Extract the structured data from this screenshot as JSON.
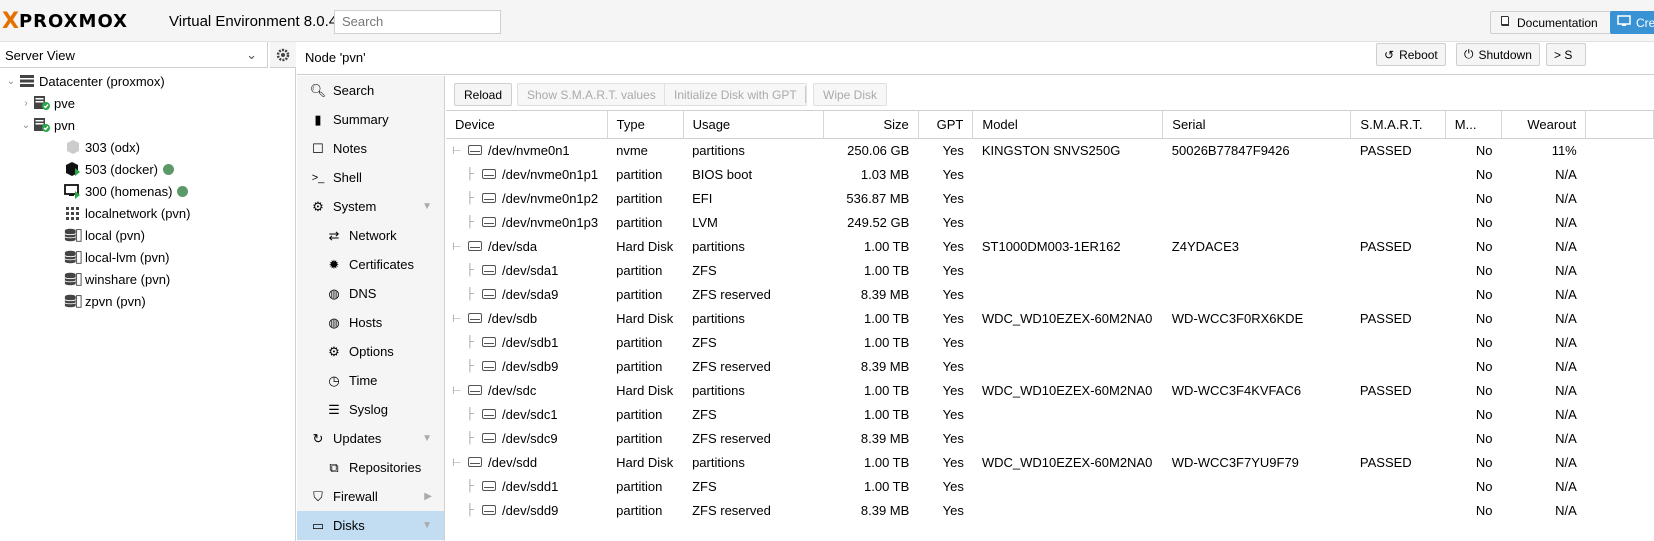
{
  "app": {
    "logo_x": "X",
    "logo_word": "PROXMOX",
    "version": "Virtual Environment 8.0.4",
    "search_placeholder": "Search",
    "documentation_label": "Documentation",
    "create_label": "Cre"
  },
  "sidebar": {
    "view_label": "Server View",
    "tree": [
      {
        "label": "Datacenter (proxmox)",
        "icon": "datacenter-icon",
        "level": 0,
        "toggle": "expanded"
      },
      {
        "label": "pve",
        "icon": "node-online-icon",
        "level": 1,
        "toggle": "collapsed"
      },
      {
        "label": "pvn",
        "icon": "node-online-icon",
        "level": 1,
        "toggle": "expanded"
      },
      {
        "label": "303 (odx)",
        "icon": "container-stopped-icon",
        "level": 2,
        "status": ""
      },
      {
        "label": "503 (docker)",
        "icon": "container-running-icon",
        "level": 2,
        "status": "tag"
      },
      {
        "label": "300 (homenas)",
        "icon": "vm-running-icon",
        "level": 2,
        "status": "tag"
      },
      {
        "label": "localnetwork (pvn)",
        "icon": "network-icon",
        "level": 2,
        "status": ""
      },
      {
        "label": "local (pvn)",
        "icon": "storage-icon",
        "level": 2,
        "status": ""
      },
      {
        "label": "local-lvm (pvn)",
        "icon": "storage-icon",
        "level": 2,
        "status": ""
      },
      {
        "label": "winshare (pvn)",
        "icon": "storage-icon",
        "level": 2,
        "status": ""
      },
      {
        "label": "zpvn (pvn)",
        "icon": "storage-icon",
        "level": 2,
        "status": ""
      }
    ]
  },
  "header": {
    "node_title": "Node 'pvn'",
    "reboot_label": "Reboot",
    "shutdown_label": "Shutdown",
    "shell_label": "> S"
  },
  "nav": [
    {
      "label": "Search",
      "icon": "search-icon",
      "sub": false
    },
    {
      "label": "Summary",
      "icon": "book-icon",
      "sub": false
    },
    {
      "label": "Notes",
      "icon": "notes-icon",
      "sub": false
    },
    {
      "label": "Shell",
      "icon": "terminal-icon",
      "sub": false
    },
    {
      "label": "System",
      "icon": "cogs-icon",
      "sub": false,
      "caret": "down"
    },
    {
      "label": "Network",
      "icon": "exchange-icon",
      "sub": true
    },
    {
      "label": "Certificates",
      "icon": "certificate-icon",
      "sub": true
    },
    {
      "label": "DNS",
      "icon": "globe-icon",
      "sub": true
    },
    {
      "label": "Hosts",
      "icon": "globe-icon",
      "sub": true
    },
    {
      "label": "Options",
      "icon": "gear-icon",
      "sub": true
    },
    {
      "label": "Time",
      "icon": "clock-icon",
      "sub": true
    },
    {
      "label": "Syslog",
      "icon": "list-icon",
      "sub": true
    },
    {
      "label": "Updates",
      "icon": "refresh-icon",
      "sub": false,
      "caret": "down"
    },
    {
      "label": "Repositories",
      "icon": "files-icon",
      "sub": true
    },
    {
      "label": "Firewall",
      "icon": "shield-icon",
      "sub": false,
      "caret": "right"
    },
    {
      "label": "Disks",
      "icon": "hdd-icon",
      "sub": false,
      "caret": "down",
      "active": true
    }
  ],
  "toolbar": {
    "reload": "Reload",
    "smart": "Show S.M.A.R.T. values",
    "init_gpt": "Initialize Disk with GPT",
    "wipe": "Wipe Disk"
  },
  "table": {
    "columns": [
      "Device",
      "Type",
      "Usage",
      "Size",
      "GPT",
      "Model",
      "Serial",
      "S.M.A.R.T.",
      "M...",
      "Wearout"
    ],
    "rows": [
      {
        "device": "/dev/nvme0n1",
        "type": "nvme",
        "usage": "partitions",
        "size": "250.06 GB",
        "gpt": "Yes",
        "model": "KINGSTON SNVS250G",
        "serial": "50026B77847F9426",
        "smart": "PASSED",
        "mounted": "No",
        "wearout": "11%",
        "child": false
      },
      {
        "device": "/dev/nvme0n1p1",
        "type": "partition",
        "usage": "BIOS boot",
        "size": "1.03 MB",
        "gpt": "Yes",
        "model": "",
        "serial": "",
        "smart": "",
        "mounted": "No",
        "wearout": "N/A",
        "child": true
      },
      {
        "device": "/dev/nvme0n1p2",
        "type": "partition",
        "usage": "EFI",
        "size": "536.87 MB",
        "gpt": "Yes",
        "model": "",
        "serial": "",
        "smart": "",
        "mounted": "No",
        "wearout": "N/A",
        "child": true
      },
      {
        "device": "/dev/nvme0n1p3",
        "type": "partition",
        "usage": "LVM",
        "size": "249.52 GB",
        "gpt": "Yes",
        "model": "",
        "serial": "",
        "smart": "",
        "mounted": "No",
        "wearout": "N/A",
        "child": true
      },
      {
        "device": "/dev/sda",
        "type": "Hard Disk",
        "usage": "partitions",
        "size": "1.00 TB",
        "gpt": "Yes",
        "model": "ST1000DM003-1ER162",
        "serial": "Z4YDACE3",
        "smart": "PASSED",
        "mounted": "No",
        "wearout": "N/A",
        "child": false
      },
      {
        "device": "/dev/sda1",
        "type": "partition",
        "usage": "ZFS",
        "size": "1.00 TB",
        "gpt": "Yes",
        "model": "",
        "serial": "",
        "smart": "",
        "mounted": "No",
        "wearout": "N/A",
        "child": true
      },
      {
        "device": "/dev/sda9",
        "type": "partition",
        "usage": "ZFS reserved",
        "size": "8.39 MB",
        "gpt": "Yes",
        "model": "",
        "serial": "",
        "smart": "",
        "mounted": "No",
        "wearout": "N/A",
        "child": true
      },
      {
        "device": "/dev/sdb",
        "type": "Hard Disk",
        "usage": "partitions",
        "size": "1.00 TB",
        "gpt": "Yes",
        "model": "WDC_WD10EZEX-60M2NA0",
        "serial": "WD-WCC3F0RX6KDE",
        "smart": "PASSED",
        "mounted": "No",
        "wearout": "N/A",
        "child": false
      },
      {
        "device": "/dev/sdb1",
        "type": "partition",
        "usage": "ZFS",
        "size": "1.00 TB",
        "gpt": "Yes",
        "model": "",
        "serial": "",
        "smart": "",
        "mounted": "No",
        "wearout": "N/A",
        "child": true
      },
      {
        "device": "/dev/sdb9",
        "type": "partition",
        "usage": "ZFS reserved",
        "size": "8.39 MB",
        "gpt": "Yes",
        "model": "",
        "serial": "",
        "smart": "",
        "mounted": "No",
        "wearout": "N/A",
        "child": true
      },
      {
        "device": "/dev/sdc",
        "type": "Hard Disk",
        "usage": "partitions",
        "size": "1.00 TB",
        "gpt": "Yes",
        "model": "WDC_WD10EZEX-60M2NA0",
        "serial": "WD-WCC3F4KVFAC6",
        "smart": "PASSED",
        "mounted": "No",
        "wearout": "N/A",
        "child": false
      },
      {
        "device": "/dev/sdc1",
        "type": "partition",
        "usage": "ZFS",
        "size": "1.00 TB",
        "gpt": "Yes",
        "model": "",
        "serial": "",
        "smart": "",
        "mounted": "No",
        "wearout": "N/A",
        "child": true
      },
      {
        "device": "/dev/sdc9",
        "type": "partition",
        "usage": "ZFS reserved",
        "size": "8.39 MB",
        "gpt": "Yes",
        "model": "",
        "serial": "",
        "smart": "",
        "mounted": "No",
        "wearout": "N/A",
        "child": true
      },
      {
        "device": "/dev/sdd",
        "type": "Hard Disk",
        "usage": "partitions",
        "size": "1.00 TB",
        "gpt": "Yes",
        "model": "WDC_WD10EZEX-60M2NA0",
        "serial": "WD-WCC3F7YU9F79",
        "smart": "PASSED",
        "mounted": "No",
        "wearout": "N/A",
        "child": false
      },
      {
        "device": "/dev/sdd1",
        "type": "partition",
        "usage": "ZFS",
        "size": "1.00 TB",
        "gpt": "Yes",
        "model": "",
        "serial": "",
        "smart": "",
        "mounted": "No",
        "wearout": "N/A",
        "child": true
      },
      {
        "device": "/dev/sdd9",
        "type": "partition",
        "usage": "ZFS reserved",
        "size": "8.39 MB",
        "gpt": "Yes",
        "model": "",
        "serial": "",
        "smart": "",
        "mounted": "No",
        "wearout": "N/A",
        "child": true
      }
    ]
  },
  "colors": {
    "brand_orange": "#e57000",
    "active_nav": "#c2ddf2",
    "create_button": "#3892d4",
    "status_tag": "#5b9a68"
  }
}
